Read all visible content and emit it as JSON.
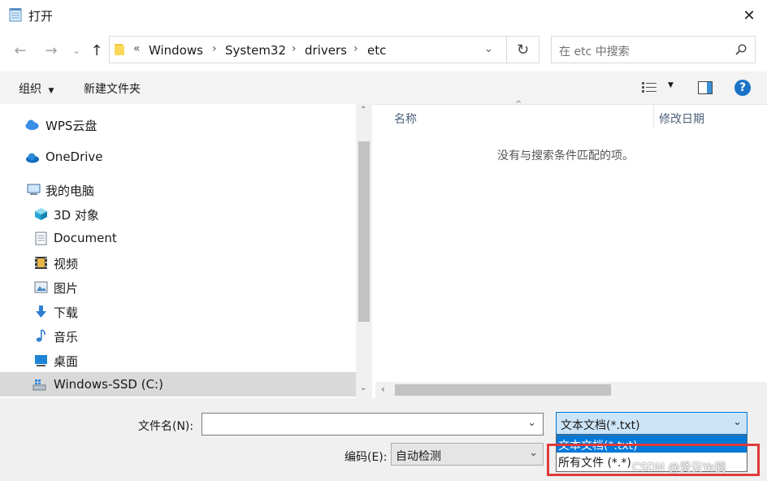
{
  "window": {
    "title": "打开"
  },
  "nav": {
    "breadcrumbs": [
      "Windows",
      "System32",
      "drivers",
      "etc"
    ],
    "search_placeholder": "在 etc 中搜索"
  },
  "toolbar": {
    "organize_label": "组织",
    "new_folder_label": "新建文件夹"
  },
  "sidebar": {
    "items": [
      {
        "label": "WPS云盘",
        "icon": "cloud-icon"
      },
      {
        "label": "OneDrive",
        "icon": "onedrive-cloud-icon"
      },
      {
        "label": "我的电脑",
        "icon": "computer-icon"
      },
      {
        "label": "3D 对象",
        "icon": "3d-objects-icon"
      },
      {
        "label": "Document",
        "icon": "document-icon"
      },
      {
        "label": "视频",
        "icon": "video-icon"
      },
      {
        "label": "图片",
        "icon": "picture-icon"
      },
      {
        "label": "下载",
        "icon": "download-icon"
      },
      {
        "label": "音乐",
        "icon": "music-icon"
      },
      {
        "label": "桌面",
        "icon": "desktop-icon"
      },
      {
        "label": "Windows-SSD (C:)",
        "icon": "drive-icon",
        "selected": true
      }
    ]
  },
  "filelist": {
    "columns": [
      "名称",
      "修改日期"
    ],
    "empty_message": "没有与搜索条件匹配的项。"
  },
  "bottom": {
    "filename_label": "文件名(N):",
    "filename_value": "",
    "encoding_label": "编码(E):",
    "encoding_value": "自动检测",
    "filetype_selected": "文本文档(*.txt)",
    "filetype_options": [
      "文本文档(*.txt)",
      "所有文件  (*.*)"
    ]
  },
  "watermark": "CSDN @贤云Ye鹤",
  "colors": {
    "accent": "#0078d7",
    "highlight_box": "#e03a3a",
    "selected_row": "#d9d9d9"
  }
}
